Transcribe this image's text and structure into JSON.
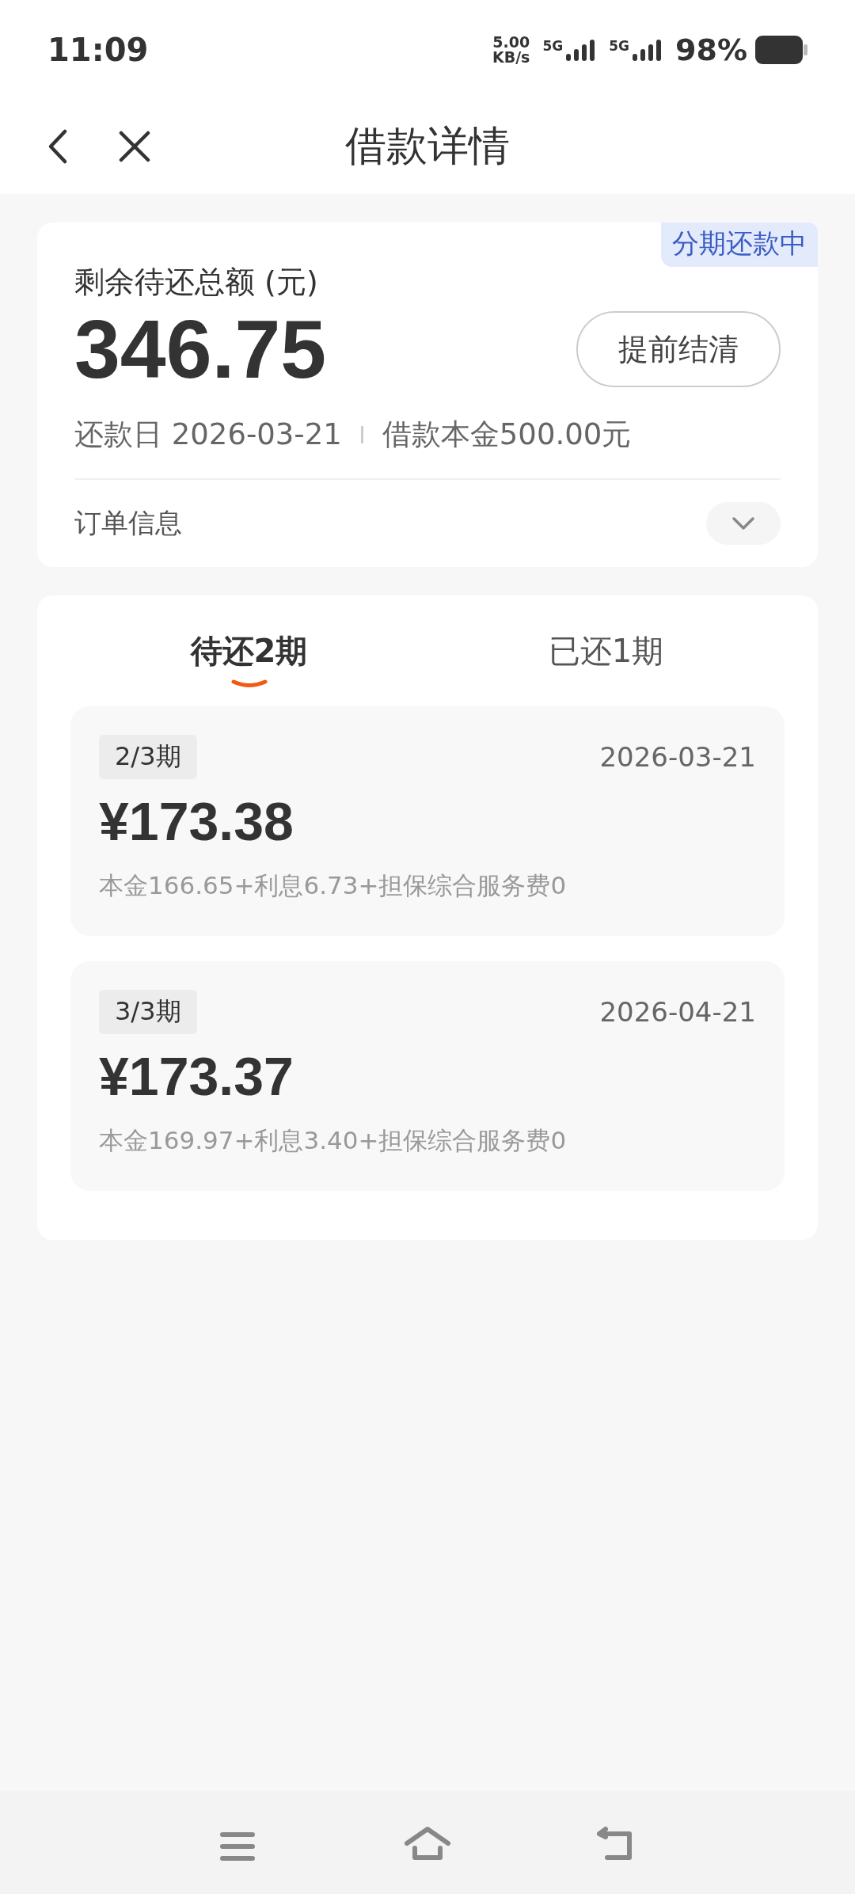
{
  "status_bar": {
    "time": "11:09",
    "speed_value": "5.00",
    "speed_unit": "KB/s",
    "network_1": "5G",
    "network_2": "5G",
    "battery": "98%"
  },
  "header": {
    "title": "借款详情"
  },
  "summary": {
    "badge": "分期还款中",
    "label": "剩余待还总额 (元)",
    "amount": "346.75",
    "payoff_button": "提前结清",
    "due_date": "还款日 2026-03-21",
    "principal": "借款本金500.00元",
    "order_info": "订单信息",
    "expanded": false
  },
  "tabs": [
    {
      "label": "待还2期",
      "selected": true
    },
    {
      "label": "已还1期",
      "selected": false
    }
  ],
  "installments": [
    {
      "period": "2/3期",
      "date": "2026-03-21",
      "amount": "¥173.38",
      "breakdown": "本金166.65+利息6.73+担保综合服务费0"
    },
    {
      "period": "3/3期",
      "date": "2026-04-21",
      "amount": "¥173.37",
      "breakdown": "本金169.97+利息3.40+担保综合服务费0"
    }
  ]
}
